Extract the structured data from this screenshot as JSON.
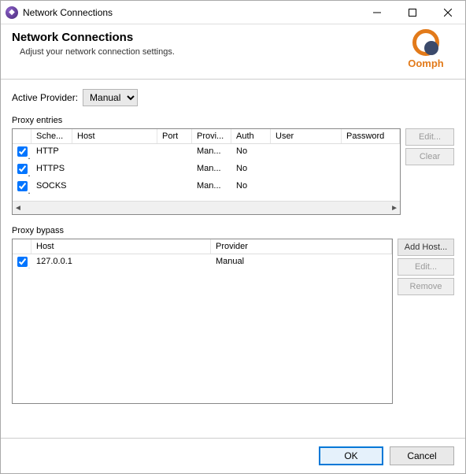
{
  "window": {
    "title": "Network Connections"
  },
  "header": {
    "title": "Network Connections",
    "subtitle": "Adjust your network connection settings.",
    "brand": "Oomph"
  },
  "provider": {
    "label": "Active Provider:",
    "value": "Manual"
  },
  "proxy_entries": {
    "label": "Proxy entries",
    "columns": [
      "Sche...",
      "Host",
      "Port",
      "Provi...",
      "Auth",
      "User",
      "Password"
    ],
    "rows": [
      {
        "checked": true,
        "scheme": "HTTP",
        "host": "",
        "port": "",
        "provider": "Man...",
        "auth": "No",
        "user": "",
        "password": ""
      },
      {
        "checked": true,
        "scheme": "HTTPS",
        "host": "",
        "port": "",
        "provider": "Man...",
        "auth": "No",
        "user": "",
        "password": ""
      },
      {
        "checked": true,
        "scheme": "SOCKS",
        "host": "",
        "port": "",
        "provider": "Man...",
        "auth": "No",
        "user": "",
        "password": ""
      }
    ],
    "buttons": {
      "edit": "Edit...",
      "clear": "Clear"
    }
  },
  "proxy_bypass": {
    "label": "Proxy bypass",
    "columns": [
      "Host",
      "Provider"
    ],
    "rows": [
      {
        "checked": true,
        "host": "127.0.0.1",
        "provider": "Manual"
      }
    ],
    "buttons": {
      "add": "Add Host...",
      "edit": "Edit...",
      "remove": "Remove"
    }
  },
  "footer": {
    "ok": "OK",
    "cancel": "Cancel"
  }
}
